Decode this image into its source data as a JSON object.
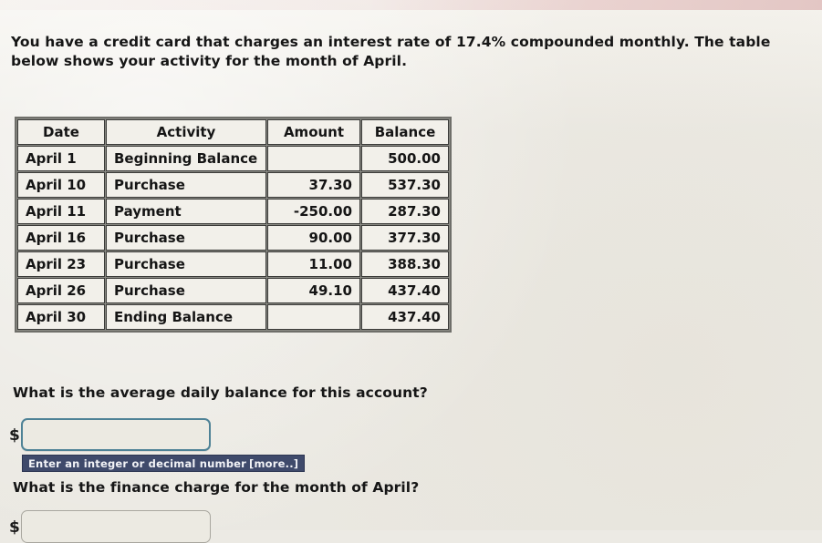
{
  "prompt": {
    "text": "You have a credit card that charges an interest rate of 17.4% compounded monthly. The table below shows your activity for the month of April."
  },
  "table": {
    "headers": {
      "date": "Date",
      "activity": "Activity",
      "amount": "Amount",
      "balance": "Balance"
    },
    "rows": [
      {
        "date": "April 1",
        "activity": "Beginning Balance",
        "amount": "",
        "balance": "500.00"
      },
      {
        "date": "April 10",
        "activity": "Purchase",
        "amount": "37.30",
        "balance": "537.30"
      },
      {
        "date": "April 11",
        "activity": "Payment",
        "amount": "-250.00",
        "balance": "287.30"
      },
      {
        "date": "April 16",
        "activity": "Purchase",
        "amount": "90.00",
        "balance": "377.30"
      },
      {
        "date": "April 23",
        "activity": "Purchase",
        "amount": "11.00",
        "balance": "388.30"
      },
      {
        "date": "April 26",
        "activity": "Purchase",
        "amount": "49.10",
        "balance": "437.40"
      },
      {
        "date": "April 30",
        "activity": "Ending Balance",
        "amount": "",
        "balance": "437.40"
      }
    ]
  },
  "questions": [
    {
      "text": "What is the average daily balance for this account?",
      "currency_symbol": "$",
      "input_value": "",
      "hint": "Enter an integer or decimal number",
      "hint_more": "[more..]"
    },
    {
      "text": "What is the finance charge for the month of April?",
      "currency_symbol": "$",
      "input_value": ""
    }
  ],
  "colors": {
    "page_background": "#eceae4",
    "focus_border": "#4e8296",
    "hint_background": "#3f4a6b",
    "hint_text": "#f2f3f7"
  }
}
